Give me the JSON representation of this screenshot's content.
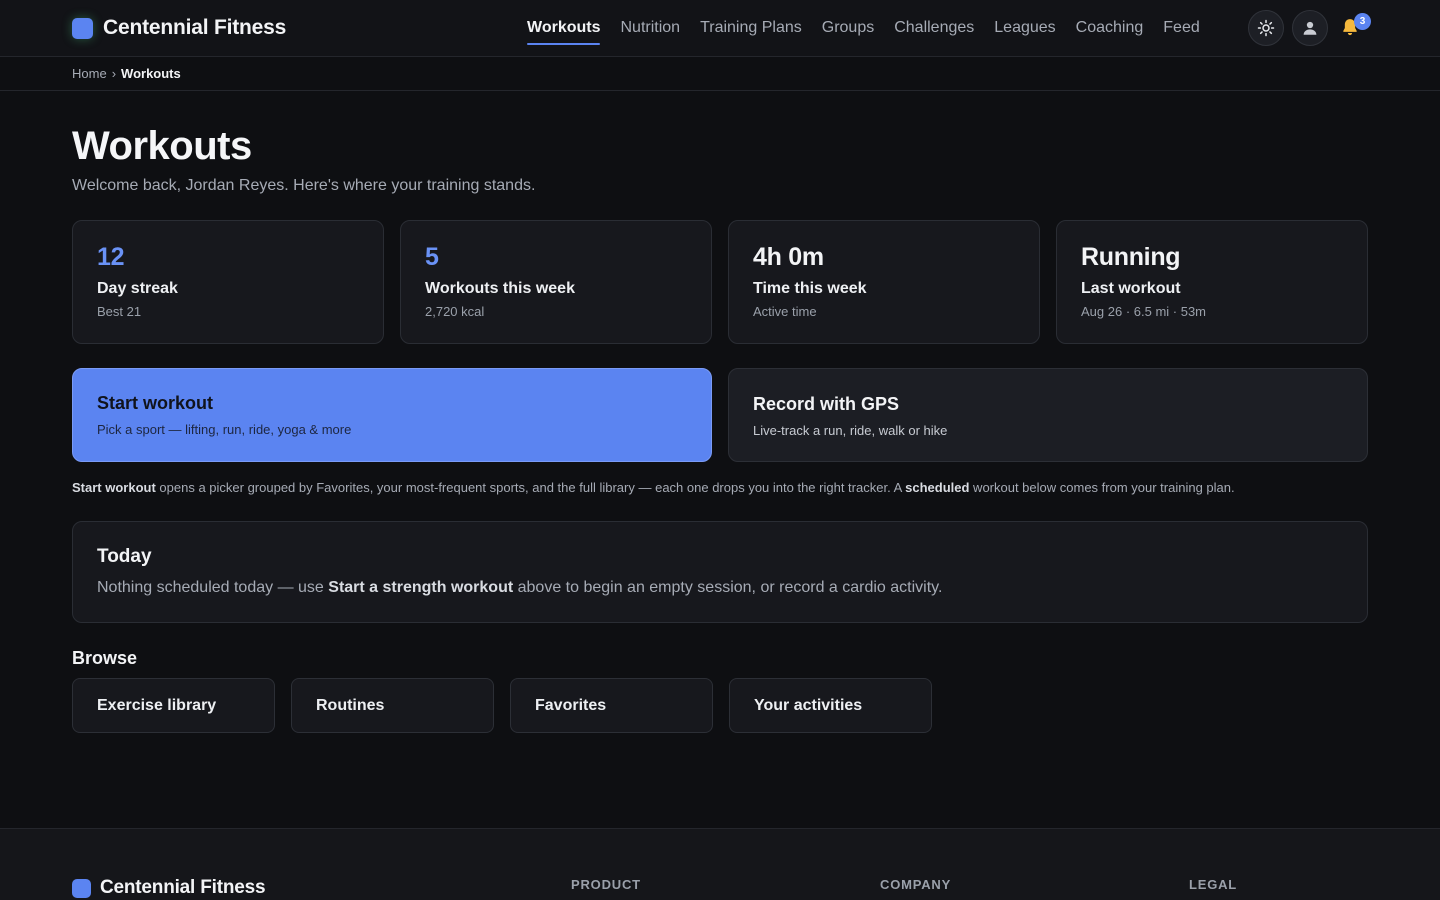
{
  "brand": {
    "name": "Centennial Fitness",
    "accent": "#5b84f1"
  },
  "nav": {
    "items": [
      {
        "label": "Workouts",
        "active": true
      },
      {
        "label": "Nutrition"
      },
      {
        "label": "Training Plans"
      },
      {
        "label": "Groups"
      },
      {
        "label": "Challenges"
      },
      {
        "label": "Leagues"
      },
      {
        "label": "Coaching"
      },
      {
        "label": "Feed"
      }
    ],
    "icons": [
      "sun-icon",
      "user-icon",
      "bell-icon"
    ],
    "notification_count": "3"
  },
  "breadcrumb": {
    "home": "Home",
    "separator": "›",
    "current": "Workouts"
  },
  "page": {
    "title": "Workouts",
    "subtitle": "Welcome back, Jordan Reyes. Here's where your training stands."
  },
  "stats": [
    {
      "value": "12",
      "label": "Day streak",
      "meta": "Best 21"
    },
    {
      "value": "5",
      "label": "Workouts this week",
      "meta": "2,720 kcal"
    },
    {
      "value": "4h 0m",
      "label": "Time this week",
      "meta": "Active time"
    },
    {
      "value": "Running",
      "label": "Last workout",
      "meta": "Aug 26 · 6.5 mi · 53m"
    }
  ],
  "actions": {
    "start": {
      "title": "Start workout",
      "subtitle": "Pick a sport — lifting, run, ride, yoga & more"
    },
    "gps": {
      "title": "Record with GPS",
      "subtitle": "Live-track a run, ride, walk or hike"
    }
  },
  "hint": {
    "b1": "Start workout",
    "t1": " opens a picker grouped by Favorites, your most-frequent sports, and the full library — each one drops you into the right tracker. A ",
    "b2": "scheduled",
    "t2": " workout below comes from your training plan."
  },
  "today": {
    "title": "Today",
    "t1": "Nothing scheduled today — use ",
    "b1": "Start a strength workout",
    "t2": " above to begin an empty session, or record a cardio activity."
  },
  "browse": {
    "title": "Browse",
    "items": [
      "Exercise library",
      "Routines",
      "Favorites",
      "Your activities"
    ]
  },
  "footer": {
    "brand": "Centennial Fitness",
    "columns": [
      "PRODUCT",
      "COMPANY",
      "LEGAL"
    ]
  }
}
